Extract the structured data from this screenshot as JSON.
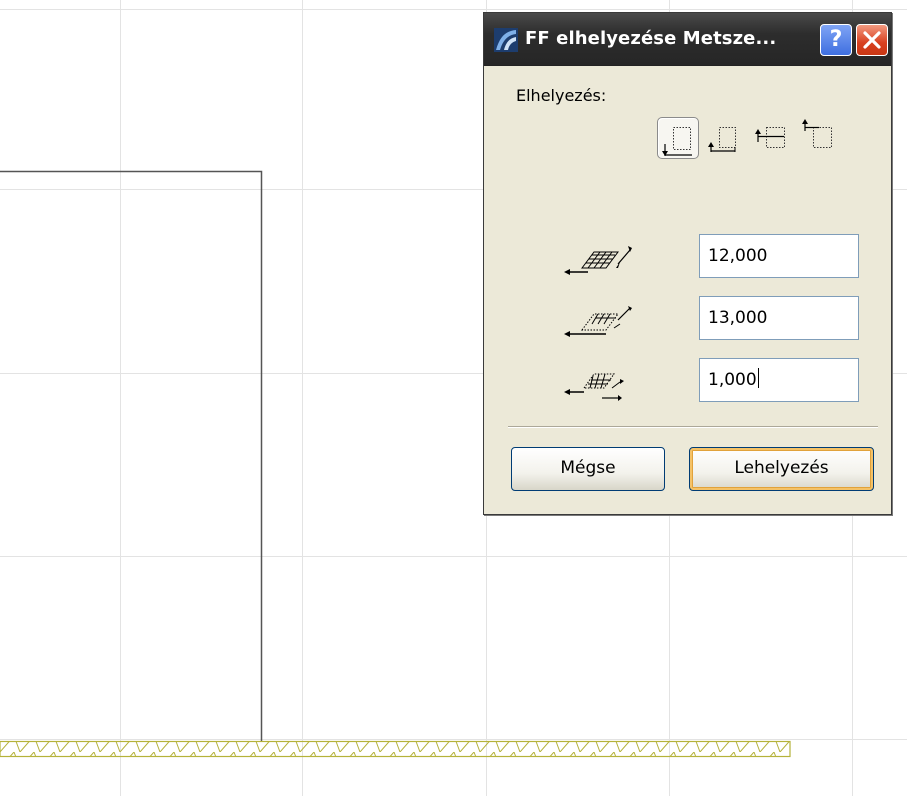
{
  "dialog": {
    "title": "FF elhelyezése Metsze...",
    "help_label": "?",
    "placement_label": "Elhelyezés:",
    "anchor_options": [
      "anchor-bottom-left",
      "anchor-bottom-left-outside",
      "anchor-center",
      "anchor-top-left"
    ],
    "selected_anchor": "anchor-bottom-left",
    "fields": [
      {
        "icon": "grid-width-icon",
        "value": "12,000"
      },
      {
        "icon": "grid-depth-icon",
        "value": "13,000"
      },
      {
        "icon": "grid-spacing-icon",
        "value": "1,000"
      }
    ],
    "cancel_label": "Mégse",
    "place_label": "Lehelyezés"
  },
  "colors": {
    "titlebar": "#2d2d2d",
    "close": "#d8401f",
    "help": "#3f6fe0",
    "hatch": "#b5b23a",
    "grid": "#e3e3e3"
  }
}
